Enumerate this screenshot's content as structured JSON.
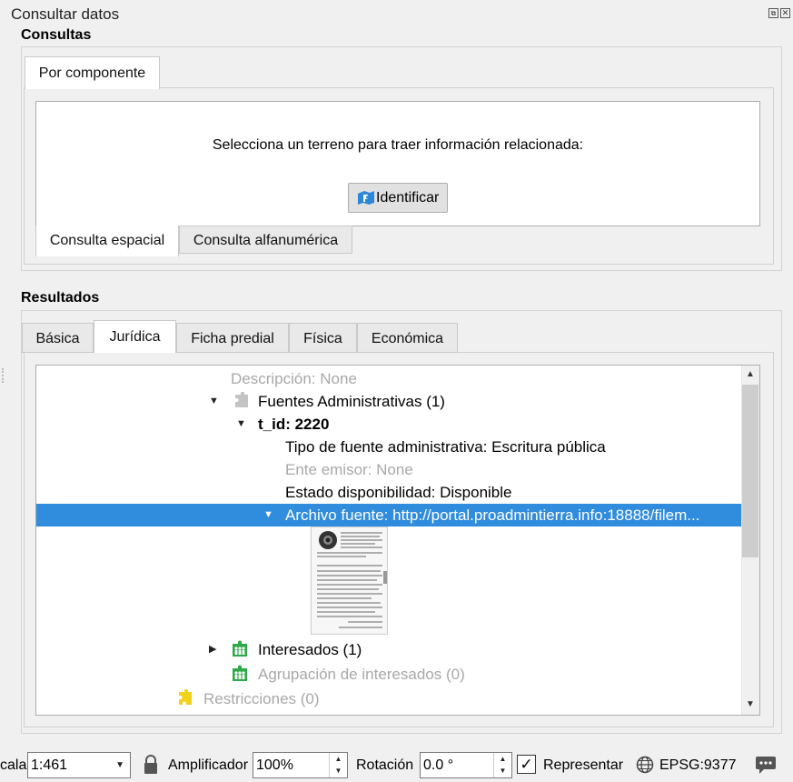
{
  "dock": {
    "title": "Consultar datos",
    "float_glyph": "⧉",
    "close_glyph": "✕"
  },
  "consultas": {
    "title": "Consultas",
    "tab_label": "Por componente",
    "instruction": "Selecciona un terreno para traer información relacionada:",
    "identify_label": "Identificar",
    "identify_icon": "identify-plot-icon",
    "subtabs": [
      "Consulta espacial",
      "Consulta alfanumérica"
    ]
  },
  "resultados": {
    "title": "Resultados",
    "tabs": [
      "Básica",
      "Jurídica",
      "Ficha predial",
      "Física",
      "Económica"
    ],
    "active_tab": "Jurídica",
    "tree": [
      {
        "text": "Descripción: None",
        "style": "grey"
      },
      {
        "text": "Fuentes Administrativas (1)",
        "icon": "puzzle-grey-icon"
      },
      {
        "text": "t_id: 2220",
        "style": "bold"
      },
      {
        "text": "Tipo de fuente administrativa: Escritura pública"
      },
      {
        "text": "Ente emisor: None",
        "style": "grey"
      },
      {
        "text": "Estado disponibilidad: Disponible"
      },
      {
        "text": "Archivo fuente: http://portal.proadmintierra.info:18888/filem...",
        "style": "selected"
      },
      {
        "text": "Interesados (1)",
        "icon": "group-green-icon"
      },
      {
        "text": "Agrupación de interesados (0)",
        "style": "grey",
        "icon": "group-green-icon"
      },
      {
        "text": "Restricciones (0)",
        "style": "grey",
        "icon": "puzzle-yellow-icon"
      }
    ]
  },
  "status_bar": {
    "scale_label": "cala",
    "scale_value": "1:461",
    "magnifier_label": "Amplificador",
    "magnifier_value": "100%",
    "rotation_label": "Rotación",
    "rotation_value": "0.0 °",
    "render_label": "Representar",
    "render_checked": true,
    "crs": "EPSG:9377"
  },
  "colors": {
    "selection": "#308cdc",
    "green_icon": "#2fa84a",
    "yellow_icon": "#f2d21b",
    "grey_icon": "#c4c4c4"
  }
}
